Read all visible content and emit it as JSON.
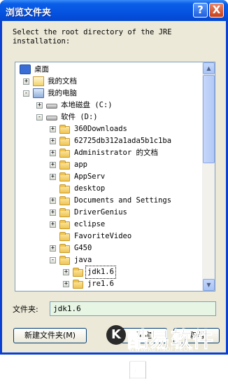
{
  "window": {
    "title": "浏览文件夹",
    "help_label": "?",
    "close_label": "X"
  },
  "prompt": "Select the root directory of the JRE\ninstallation:",
  "tree": {
    "items": [
      {
        "label": "桌面",
        "icon": "desktop-icon",
        "expander": ""
      },
      {
        "label": "我的文档",
        "icon": "my-documents-icon",
        "expander": "+"
      },
      {
        "label": "我的电脑",
        "icon": "my-computer-icon",
        "expander": "-"
      },
      {
        "label": "本地磁盘 (C:)",
        "icon": "drive-icon",
        "expander": "+"
      },
      {
        "label": "软件 (D:)",
        "icon": "drive-icon",
        "expander": "-"
      },
      {
        "label": "360Downloads",
        "icon": "folder-icon",
        "expander": "+"
      },
      {
        "label": "62725db312a1ada5b1c1ba",
        "icon": "folder-icon",
        "expander": "+"
      },
      {
        "label": "Administrator 的文档",
        "icon": "folder-icon",
        "expander": "+"
      },
      {
        "label": "app",
        "icon": "folder-icon",
        "expander": "+"
      },
      {
        "label": "AppServ",
        "icon": "folder-icon",
        "expander": "+"
      },
      {
        "label": "desktop",
        "icon": "folder-icon",
        "expander": ""
      },
      {
        "label": "Documents and Settings",
        "icon": "folder-icon",
        "expander": "+"
      },
      {
        "label": "DriverGenius",
        "icon": "folder-icon",
        "expander": "+"
      },
      {
        "label": "eclipse",
        "icon": "folder-icon",
        "expander": "+"
      },
      {
        "label": "FavoriteVideo",
        "icon": "folder-icon",
        "expander": ""
      },
      {
        "label": "G450",
        "icon": "folder-icon",
        "expander": "+"
      },
      {
        "label": "java",
        "icon": "folder-icon",
        "expander": "-"
      },
      {
        "label": "jdk1.6",
        "icon": "folder-icon",
        "expander": "+",
        "selected": true
      },
      {
        "label": "jre1.6",
        "icon": "folder-icon",
        "expander": "+"
      }
    ],
    "scroll_up": "▲",
    "scroll_down": "▼"
  },
  "folder_field": {
    "label": "文件夹:",
    "value": "jdk1.6"
  },
  "buttons": {
    "new_folder": "新建文件夹(M)",
    "ok": "确定",
    "cancel": "取消"
  },
  "watermark": {
    "logo": "K",
    "text": "酷易软件园",
    "url": "WWW.KUYISOFT.COM"
  }
}
